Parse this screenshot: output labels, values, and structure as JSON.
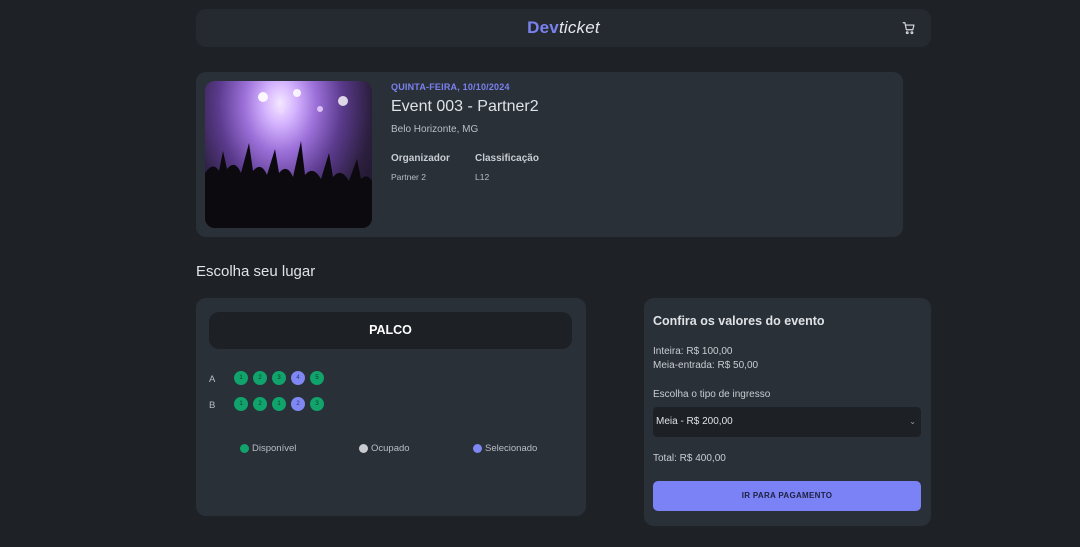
{
  "header": {
    "logo_dev": "Dev",
    "logo_ticket": "ticket",
    "cart_icon": "cart-icon"
  },
  "event": {
    "date": "QUINTA-FEIRA, 10/10/2024",
    "title": "Event 003 - Partner2",
    "city": "Belo Horizonte, MG",
    "organizer_label": "Organizador",
    "organizer_value": "Partner 2",
    "rating_label": "Classificação",
    "rating_value": "L12"
  },
  "seats": {
    "section_title": "Escolha seu lugar",
    "stage_label": "PALCO",
    "rows": [
      {
        "label": "A",
        "seats": [
          {
            "number": "1",
            "status": "free"
          },
          {
            "number": "2",
            "status": "free"
          },
          {
            "number": "3",
            "status": "free"
          },
          {
            "number": "4",
            "status": "selected"
          },
          {
            "number": "5",
            "status": "free"
          }
        ]
      },
      {
        "label": "B",
        "seats": [
          {
            "number": "1",
            "status": "free"
          },
          {
            "number": "2",
            "status": "free"
          },
          {
            "number": "1",
            "status": "free"
          },
          {
            "number": "2",
            "status": "selected"
          },
          {
            "number": "3",
            "status": "free"
          }
        ]
      }
    ],
    "legend": {
      "available": "Disponível",
      "occupied": "Ocupado",
      "selected": "Selecionado"
    },
    "colors": {
      "available": "#10a36b",
      "occupied": "#c8cbd0",
      "selected": "#7f87f2"
    }
  },
  "prices": {
    "title": "Confira os valores do evento",
    "full": "Inteira: R$ 100,00",
    "half": "Meia-entrada: R$ 50,00",
    "ticket_type_label": "Escolha o tipo de ingresso",
    "ticket_type_selected": "Meia - R$ 200,00",
    "total": "Total: R$ 400,00",
    "pay_button": "IR PARA PAGAMENTO"
  }
}
